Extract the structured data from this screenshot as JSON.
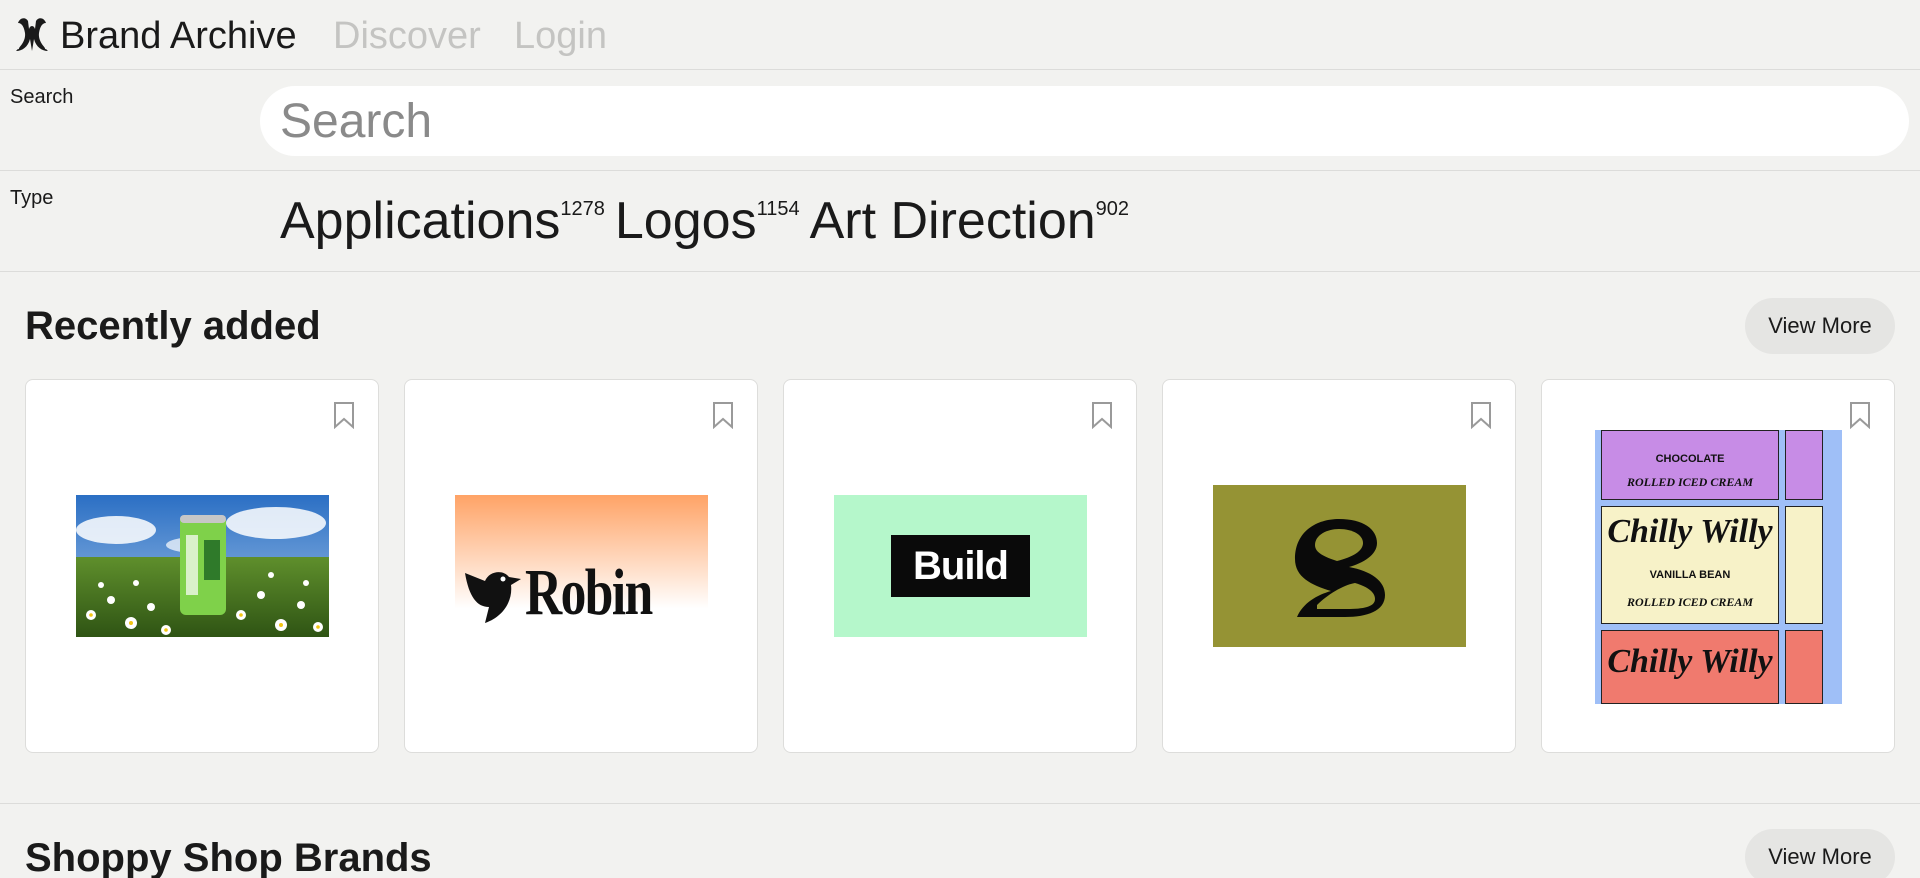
{
  "header": {
    "brand": "Brand Archive",
    "nav": [
      "Discover",
      "Login"
    ]
  },
  "filters": {
    "search_label": "Search",
    "search_placeholder": "Search",
    "type_label": "Type",
    "types": [
      {
        "name": "Applications",
        "count": "1278"
      },
      {
        "name": "Logos",
        "count": "1154"
      },
      {
        "name": "Art Direction",
        "count": "902"
      }
    ]
  },
  "sections": [
    {
      "title": "Recently added",
      "button": "View More"
    },
    {
      "title": "Shoppy Shop Brands",
      "button": "View More"
    }
  ],
  "cards": [
    {
      "image": "soda-can-in-daisy-field"
    },
    {
      "image": "robin-logo",
      "text": "Robin"
    },
    {
      "image": "build-logo",
      "text": "Build"
    },
    {
      "image": "abstract-s-mark"
    },
    {
      "image": "chilly-willy-packaging",
      "brand_text": "Chilly Willy",
      "flavors": [
        "CHOCOLATE",
        "VANILLA BEAN"
      ],
      "product": "ROLLED ICED CREAM"
    }
  ],
  "colors": {
    "background": "#f2f2f0",
    "card_green": "#b5f7cb",
    "card_olive": "#959334",
    "robin_gradient_top": "#ffa366",
    "chilly_blue": "#9fbff7",
    "chilly_purple": "#c78ce6",
    "chilly_cream": "#f7f2c8",
    "chilly_red": "#f07a6e"
  }
}
